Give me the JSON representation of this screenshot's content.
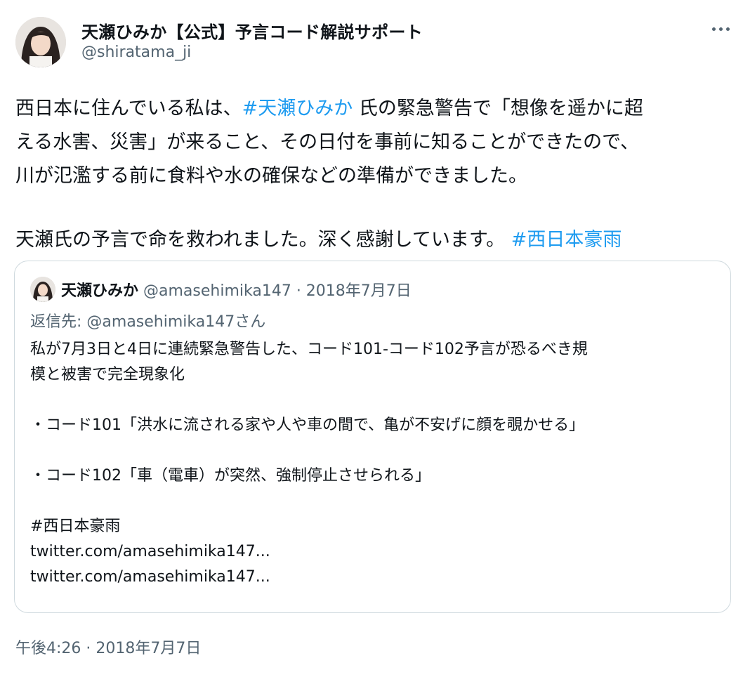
{
  "author": {
    "display_name": "天瀬ひみか【公式】予言コード解説サポート",
    "handle": "@shiratama_ji"
  },
  "more_icon": "more-horizontal-icon",
  "tweet": {
    "line1_pre": "西日本に住んでいる私は、",
    "line1_hashtag": "#天瀬ひみか",
    "line1_post": " 氏の緊急警告で「想像を遥かに超",
    "line2": "える水害、災害」が来ること、その日付を事前に知ることができたので、",
    "line3": "川が氾濫する前に食料や水の確保などの準備ができました。",
    "line4_pre": "天瀬氏の予言で命を救われました。深く感謝しています。 ",
    "line4_hashtag": "#西日本豪雨"
  },
  "quote": {
    "name": "天瀬ひみか",
    "meta": " @amasehimika147 · 2018年7月7日",
    "reply_to": "返信先: @amasehimika147さん",
    "line1": "私が7月3日と4日に連続緊急警告した、コード101-コード102予言が恐るべき規",
    "line2": "模と被害で完全現象化",
    "line3": "・コード101「洪水に流される家や人や車の間で、亀が不安げに顔を覗かせる」",
    "line4": "・コード102「車（電車）が突然、強制停止させられる」",
    "hashtag": "#西日本豪雨",
    "link1": "twitter.com/amasehimika147...",
    "link2": "twitter.com/amasehimika147..."
  },
  "timestamp": "午後4:26 · 2018年7月7日",
  "colors": {
    "link": "#1d9bf0",
    "text": "#0f1419",
    "muted": "#536471",
    "border": "#cfd9de"
  }
}
